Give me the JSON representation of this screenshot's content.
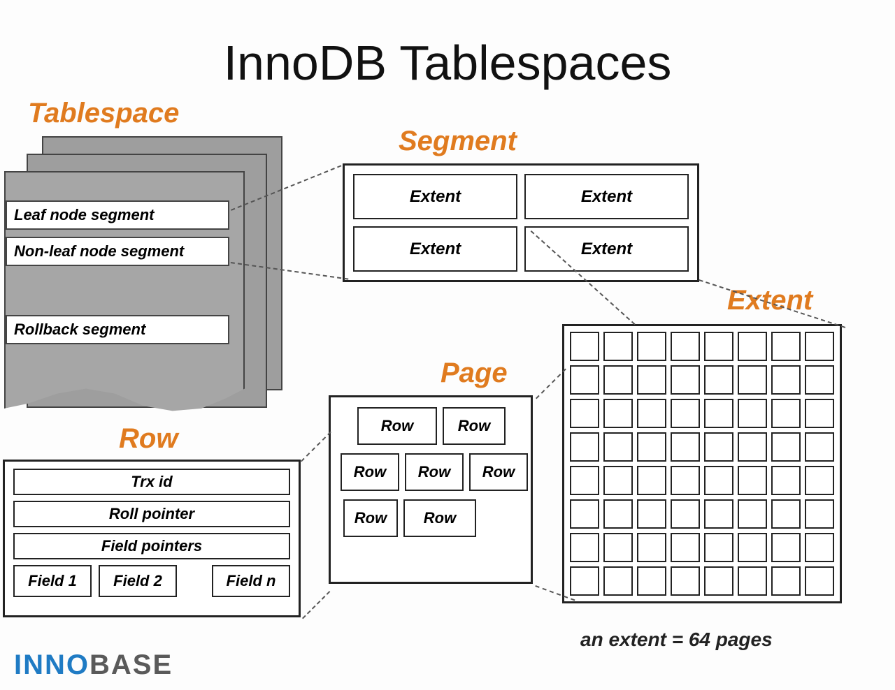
{
  "title": "InnoDB Tablespaces",
  "labels": {
    "tablespace": "Tablespace",
    "segment": "Segment",
    "page": "Page",
    "row": "Row",
    "extent": "Extent"
  },
  "tablespace_items": {
    "leaf": "Leaf node segment",
    "nonleaf": "Non-leaf node segment",
    "rollback": "Rollback segment"
  },
  "segment_cells": [
    "Extent",
    "Extent",
    "Extent",
    "Extent"
  ],
  "page_rows": {
    "r1a": "Row",
    "r1b": "Row",
    "r2a": "Row",
    "r2b": "Row",
    "r2c": "Row",
    "r3a": "Row",
    "r3b": "Row"
  },
  "row_box": {
    "trx": "Trx id",
    "roll": "Roll pointer",
    "fieldptrs": "Field pointers",
    "f1": "Field 1",
    "f2": "Field 2",
    "fn": "Field n"
  },
  "footnote": "an extent = 64 pages",
  "logo": {
    "inno": "INNO",
    "base": "BASE"
  },
  "extent_pages": 64
}
